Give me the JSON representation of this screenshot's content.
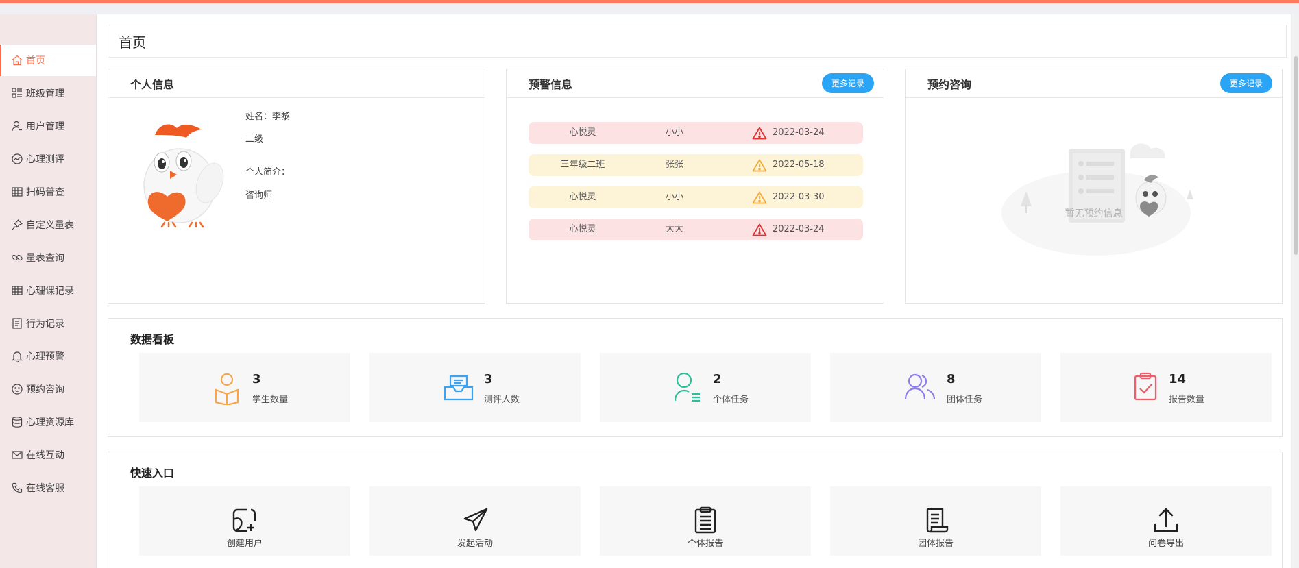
{
  "sidebar": {
    "items": [
      {
        "label": "首页",
        "icon": "home-icon"
      },
      {
        "label": "班级管理",
        "icon": "class-grid-icon"
      },
      {
        "label": "用户管理",
        "icon": "user-icon"
      },
      {
        "label": "心理测评",
        "icon": "chart-circle-icon"
      },
      {
        "label": "扫码普查",
        "icon": "table-icon"
      },
      {
        "label": "自定义量表",
        "icon": "pin-icon"
      },
      {
        "label": "量表查询",
        "icon": "link-icon"
      },
      {
        "label": "心理课记录",
        "icon": "table-icon"
      },
      {
        "label": "行为记录",
        "icon": "document-icon"
      },
      {
        "label": "心理预警",
        "icon": "bell-icon"
      },
      {
        "label": "预约咨询",
        "icon": "smile-icon"
      },
      {
        "label": "心理资源库",
        "icon": "database-icon"
      },
      {
        "label": "在线互动",
        "icon": "mail-icon"
      },
      {
        "label": "在线客服",
        "icon": "phone-icon"
      }
    ]
  },
  "page_title": "首页",
  "profile": {
    "title": "个人信息",
    "name_line": "姓名：李黎",
    "level": "二级",
    "intro_label": "个人简介：",
    "intro_value": "咨询师"
  },
  "warnings": {
    "title": "预警信息",
    "more_label": "更多记录",
    "rows": [
      {
        "group": "心悦灵",
        "name": "小小",
        "date": "2022-03-24",
        "level": "red"
      },
      {
        "group": "三年级二班",
        "name": "张张",
        "date": "2022-05-18",
        "level": "yellow"
      },
      {
        "group": "心悦灵",
        "name": "小小",
        "date": "2022-03-30",
        "level": "yellow"
      },
      {
        "group": "心悦灵",
        "name": "大大",
        "date": "2022-03-24",
        "level": "red"
      }
    ]
  },
  "appointments": {
    "title": "预约咨询",
    "more_label": "更多记录",
    "empty_text": "暂无预约信息"
  },
  "dashboard": {
    "title": "数据看板",
    "stats": [
      {
        "value": "3",
        "label": "学生数量",
        "icon": "student-book-icon",
        "color": "#f7a54a"
      },
      {
        "value": "3",
        "label": "测评人数",
        "icon": "inbox-tray-icon",
        "color": "#3aa3f3"
      },
      {
        "value": "2",
        "label": "个体任务",
        "icon": "user-list-icon",
        "color": "#2bbf9a"
      },
      {
        "value": "8",
        "label": "团体任务",
        "icon": "users-group-icon",
        "color": "#8c7cf0"
      },
      {
        "value": "14",
        "label": "报告数量",
        "icon": "clipboard-check-icon",
        "color": "#f25b6a"
      }
    ]
  },
  "quick": {
    "title": "快速入口",
    "items": [
      {
        "label": "创建用户",
        "icon": "create-user-icon"
      },
      {
        "label": "发起活动",
        "icon": "send-plane-icon"
      },
      {
        "label": "个体报告",
        "icon": "clipboard-icon"
      },
      {
        "label": "团体报告",
        "icon": "scroll-report-icon"
      },
      {
        "label": "问卷导出",
        "icon": "upload-export-icon"
      }
    ]
  },
  "colors": {
    "accent": "#ff6a4a",
    "top_bar": "#ff7b5c",
    "button_blue": "#2aa4f4",
    "warn_red_bg": "#fde2e4",
    "warn_yellow_bg": "#fdf3d6",
    "warn_red_icon": "#e03030",
    "warn_yellow_icon": "#f2a93b"
  }
}
